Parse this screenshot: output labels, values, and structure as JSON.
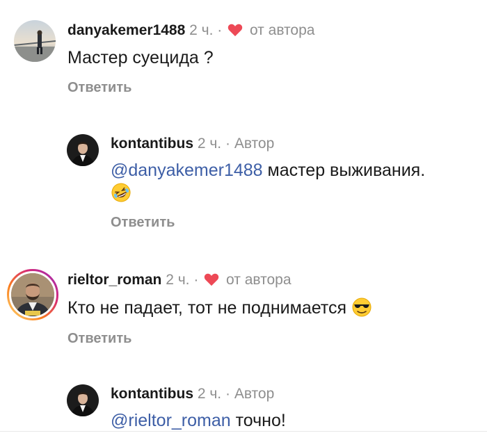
{
  "comments": [
    {
      "username": "danyakemer1488",
      "time": "2 ч.",
      "separator": "·",
      "liked_label": "от автора",
      "text": "Мастер суецида ?",
      "reply_label": "Ответить"
    },
    {
      "username": "kontantibus",
      "time": "2 ч.",
      "separator": "·",
      "author_label": "Автор",
      "mention": "@danyakemer1488",
      "text": "мастер выживания.",
      "emoji": "rolling-on-floor-laughing-emoji",
      "reply_label": "Ответить"
    },
    {
      "username": "rieltor_roman",
      "time": "2 ч.",
      "separator": "·",
      "liked_label": "от автора",
      "text": "Кто не падает, тот не поднимается",
      "emoji": "smiling-face-with-sunglasses-emoji",
      "reply_label": "Ответить"
    },
    {
      "username": "kontantibus",
      "time": "2 ч.",
      "separator": "·",
      "author_label": "Автор",
      "mention": "@rieltor_roman",
      "text": "точно!"
    }
  ],
  "colors": {
    "heart": "#ed4956",
    "mention": "#3d5ea6",
    "muted": "#8e8e8e",
    "story_ring": [
      "#feda75",
      "#fa7e1e",
      "#d62976",
      "#962fbf"
    ]
  }
}
